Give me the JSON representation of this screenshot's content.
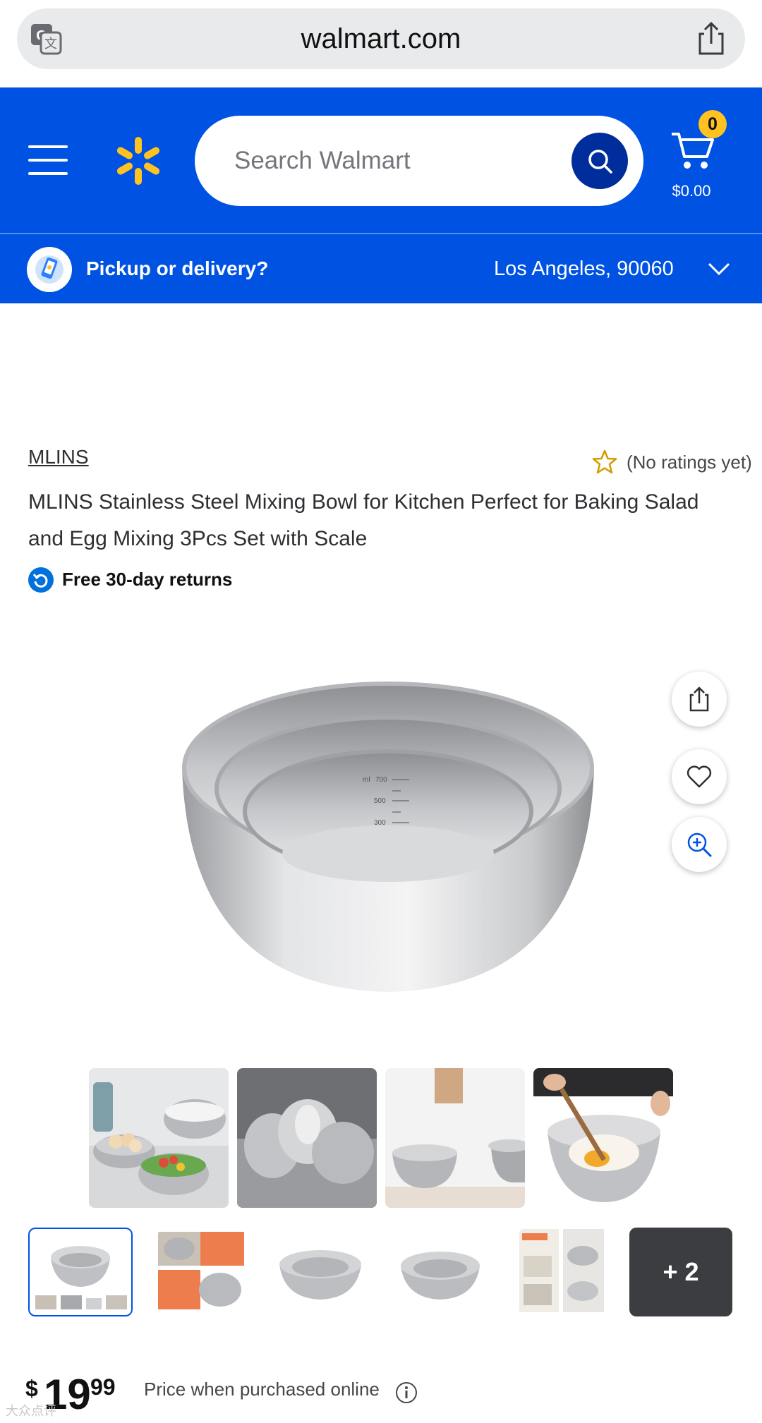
{
  "browser": {
    "url": "walmart.com",
    "translate_icon": "translate-icon",
    "share_icon": "share-icon"
  },
  "header": {
    "menu_icon": "hamburger-menu-icon",
    "logo": "walmart-spark-logo",
    "search_placeholder": "Search Walmart",
    "search_icon": "search-icon",
    "cart_count": "0",
    "cart_total": "$0.00",
    "colors": {
      "brand_blue": "#0053e2",
      "spark_yellow": "#ffc220",
      "search_button": "#002d9c"
    }
  },
  "pickup": {
    "label": "Pickup or delivery?",
    "location": "Los Angeles, 90060"
  },
  "product": {
    "brand": "MLINS",
    "rating_text": "(No ratings yet)",
    "title": "MLINS Stainless Steel Mixing Bowl for Kitchen Perfect for Baking Salad and Egg Mixing 3Pcs Set with Scale",
    "returns": "Free 30-day returns",
    "bowl_markings": [
      "ml",
      "700",
      "500",
      "300"
    ],
    "actions": [
      "share-icon",
      "heart-icon",
      "zoom-in-icon"
    ],
    "gallery_more": "+ 2",
    "price": {
      "dollar_sign": "$",
      "whole": "19",
      "cents": "99"
    },
    "price_note": "Price when purchased online"
  },
  "watermark": "大众点评"
}
